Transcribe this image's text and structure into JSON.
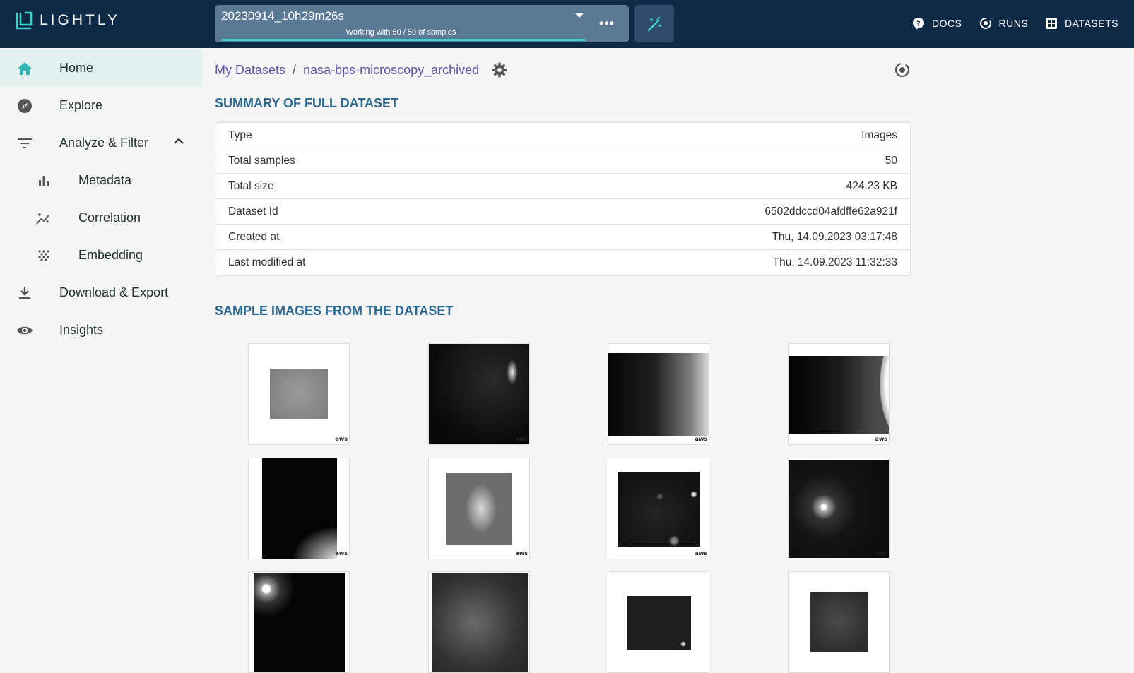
{
  "app": {
    "logo_text": "LIGHTLY"
  },
  "tag_selector": {
    "name": "20230914_10h29m26s",
    "subtitle": "Working with 50 / 50 of samples",
    "progress": 1.0
  },
  "nav": {
    "docs": "DOCS",
    "runs": "RUNS",
    "datasets": "DATASETS"
  },
  "sidebar": {
    "items": [
      {
        "label": "Home",
        "icon": "home-icon"
      },
      {
        "label": "Explore",
        "icon": "compass-icon"
      },
      {
        "label": "Analyze & Filter",
        "icon": "filter-icon"
      },
      {
        "label": "Metadata",
        "icon": "bar-chart-icon"
      },
      {
        "label": "Correlation",
        "icon": "sparkle-chart-icon"
      },
      {
        "label": "Embedding",
        "icon": "scatter-dots-icon"
      },
      {
        "label": "Download & Export",
        "icon": "download-icon"
      },
      {
        "label": "Insights",
        "icon": "eye-icon"
      }
    ]
  },
  "breadcrumb": {
    "root": "My Datasets",
    "separator": "/",
    "current": "nasa-bps-microscopy_archived"
  },
  "summary": {
    "title": "SUMMARY OF FULL DATASET",
    "rows": [
      {
        "label": "Type",
        "value": "Images"
      },
      {
        "label": "Total samples",
        "value": "50"
      },
      {
        "label": "Total size",
        "value": "424.23 KB"
      },
      {
        "label": "Dataset Id",
        "value": "6502ddccd04afdffe62a921f"
      },
      {
        "label": "Created at",
        "value": "Thu, 14.09.2023 03:17:48"
      },
      {
        "label": "Last modified at",
        "value": "Thu, 14.09.2023 11:32:33"
      }
    ]
  },
  "samples": {
    "title": "SAMPLE IMAGES FROM THE DATASET",
    "badge": "aws"
  },
  "colors": {
    "topbar": "#0e2a47",
    "accent": "#3ad1cf",
    "link": "#5c55a8",
    "section": "#2c6890"
  }
}
